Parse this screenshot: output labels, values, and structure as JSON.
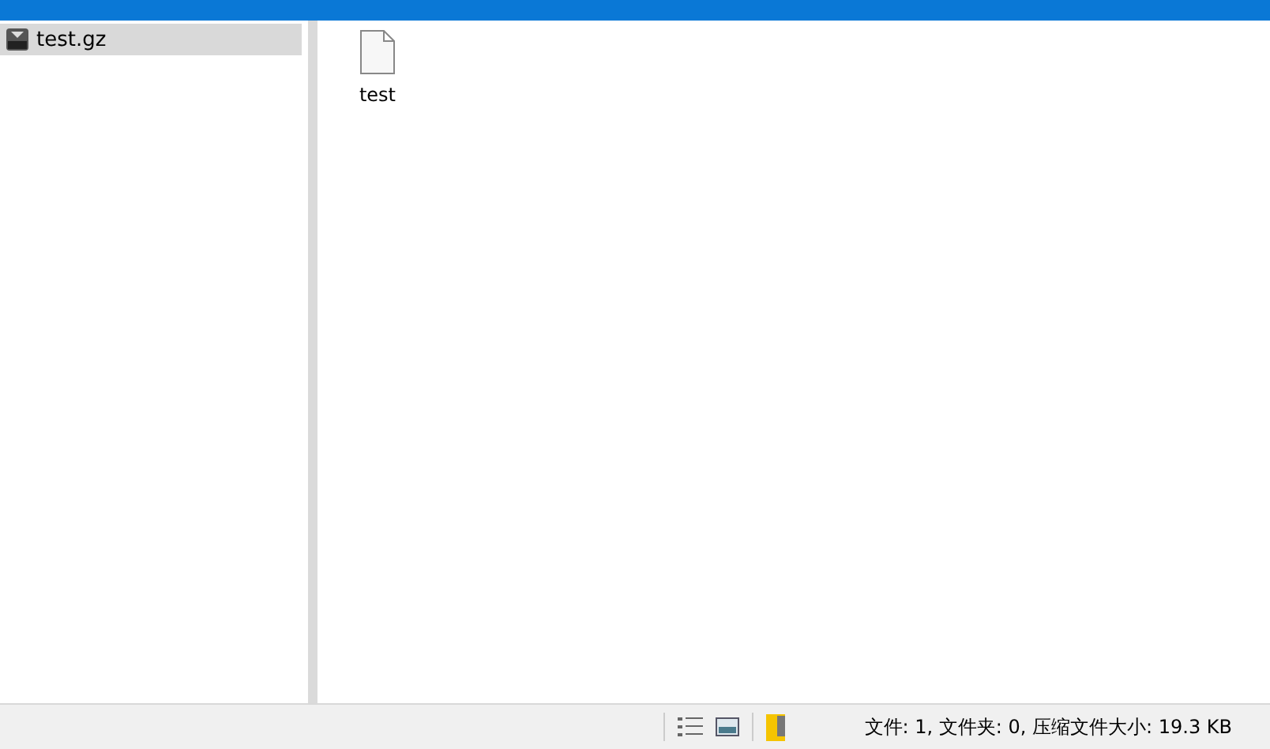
{
  "tree": {
    "items": [
      {
        "label": "test.gz",
        "selected": true
      }
    ]
  },
  "files": [
    {
      "name": "test"
    }
  ],
  "status_bar": {
    "text": "文件: 1, 文件夹: 0, 压缩文件大小: 19.3 KB"
  }
}
